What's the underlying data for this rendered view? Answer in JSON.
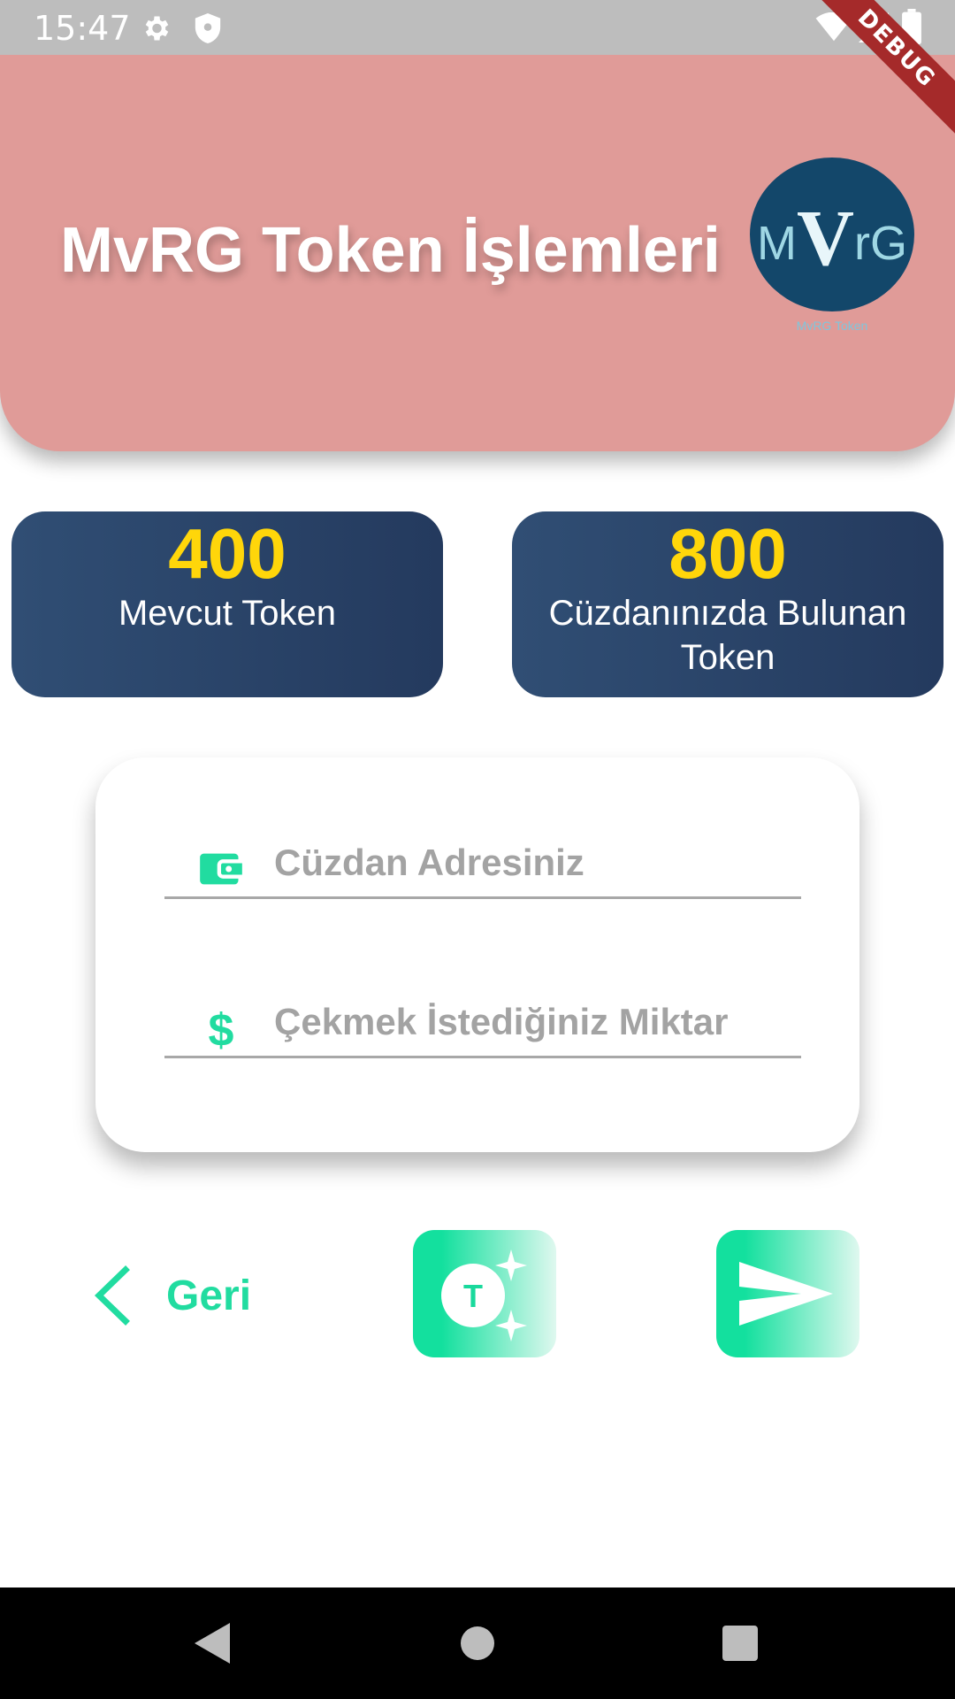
{
  "status_bar": {
    "time": "15:47",
    "icons": [
      "gear-icon",
      "shield-icon",
      "wifi-icon",
      "signal-icon",
      "battery-icon"
    ]
  },
  "debug_banner": "DEBUG",
  "header": {
    "title": "MvRG Token İşlemleri",
    "background_color": "#e09b98",
    "logo": {
      "text_m": "M",
      "text_v": "V",
      "text_rg": "rG",
      "caption": "MvRG Token"
    }
  },
  "cards": [
    {
      "value": "400",
      "label": "Mevcut Token"
    },
    {
      "value": "800",
      "label": "Cüzdanınızda Bulunan Token"
    }
  ],
  "form": {
    "wallet_field": {
      "placeholder": "Cüzdan Adresiniz",
      "value": "",
      "icon": "wallet-icon"
    },
    "amount_field": {
      "placeholder": "Çekmek İstediğiniz Miktar",
      "value": "",
      "icon": "dollar-icon"
    }
  },
  "actions": {
    "back_label": "Geri",
    "token_button_icon": "token-sparkle-icon",
    "token_glyph": "T",
    "send_button_icon": "send-icon"
  },
  "colors": {
    "accent": "#21dca0",
    "card_value": "#ffd60a",
    "card_bg": "#2b466c"
  },
  "nav_bar": {
    "icons": [
      "nav-back-icon",
      "nav-home-icon",
      "nav-recents-icon"
    ]
  }
}
